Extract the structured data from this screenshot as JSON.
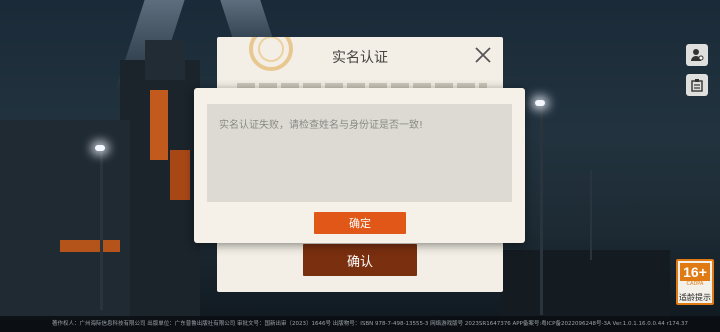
{
  "side_buttons": [
    {
      "icon": "user-gear-icon"
    },
    {
      "icon": "notice-board-icon"
    }
  ],
  "age_rating": {
    "value": "16+",
    "org": "CADPA",
    "hint": "适龄提示"
  },
  "footer": {
    "text": "著作权人：广州海际信息科技有限公司 出版单位：广东普鲁出版社有限公司 审批文号：国新出审〔2023〕1646号 出版物号：ISBN 978-7-498-13555-3 网络游戏版号 2023SR1647376 APP备案号:粤ICP备2022096248号-3A Ver.1.0.1.16.0.0.44 r174.37"
  },
  "back_panel": {
    "title": "实名认证",
    "confirm_label": "确认"
  },
  "dialog": {
    "message": "实名认证失败，请检查姓名与身份证是否一致!",
    "ok_label": "确定"
  },
  "colors": {
    "confirm_button": "#7a2f0f",
    "ok_button": "#e05717",
    "age_badge": "#e07a12",
    "panel_bg": "#f3efe6"
  }
}
